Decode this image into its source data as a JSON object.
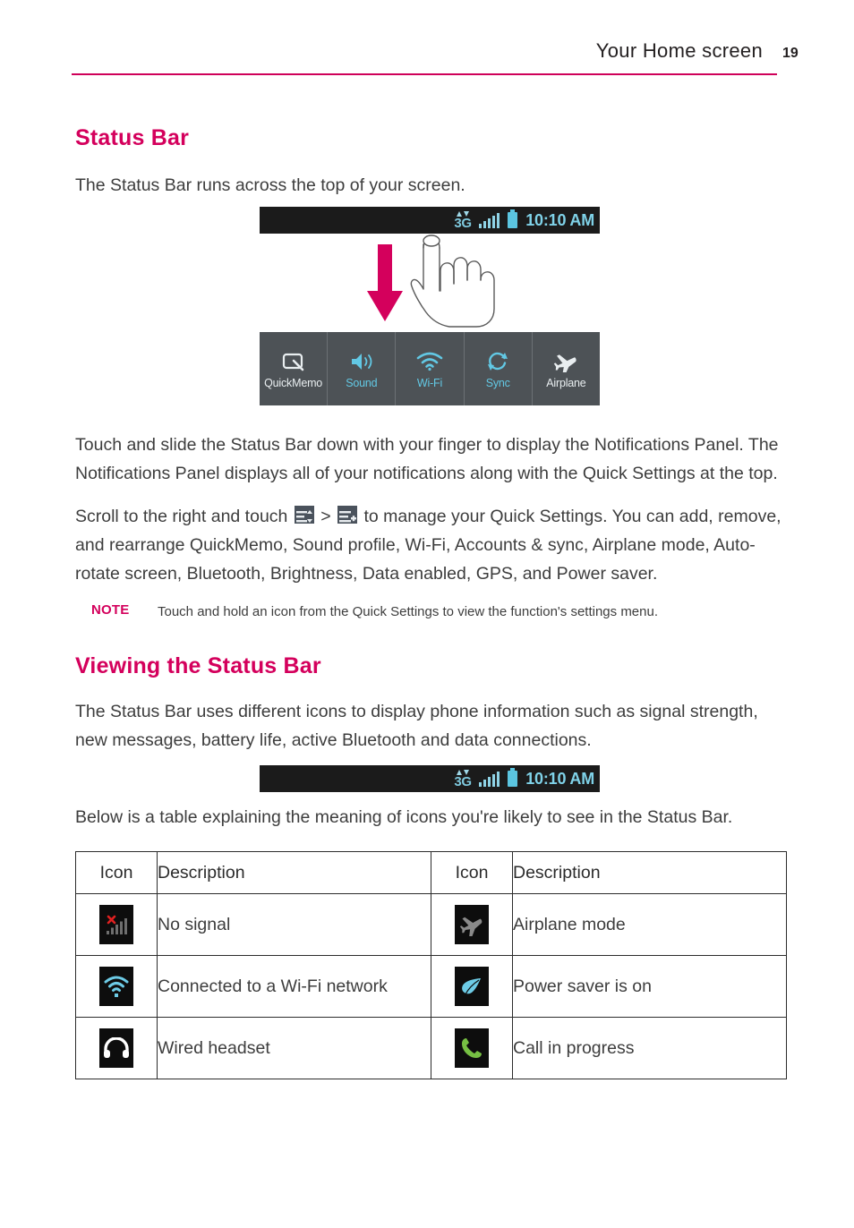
{
  "header": {
    "title": "Your Home screen",
    "page_number": "19",
    "rule_color": "#cf0059"
  },
  "sections": [
    {
      "heading": "Status Bar",
      "intro": "The Status Bar runs across the top of your screen."
    },
    {
      "heading": "Viewing the Status Bar",
      "intro": "The Status Bar uses different icons to display phone information such as signal strength, new messages, battery life, active Bluetooth and data connections."
    }
  ],
  "status_bar": {
    "network_label": "3G",
    "clock": "10:10 AM",
    "icons": [
      "data-up-down-arrows-icon",
      "signal-bars-icon",
      "battery-icon"
    ],
    "background": "#1b1b1b",
    "accent": "#7fd2e8"
  },
  "quick_settings": {
    "items": [
      {
        "label": "QuickMemo",
        "icon": "quickmemo-icon",
        "state": "inactive"
      },
      {
        "label": "Sound",
        "icon": "sound-speaker-icon",
        "state": "active"
      },
      {
        "label": "Wi-Fi",
        "icon": "wifi-icon",
        "state": "active"
      },
      {
        "label": "Sync",
        "icon": "sync-icon",
        "state": "active"
      },
      {
        "label": "Airplane",
        "icon": "airplane-icon",
        "state": "inactive"
      }
    ],
    "background": "#4d5256",
    "active_color": "#62c8e4",
    "inactive_color": "#e9eef0"
  },
  "paragraphs": {
    "p_notifications": "Touch and slide the Status Bar down with your finger to display the Notifications Panel. The Notifications Panel displays all of your notifications along with the Quick Settings at the top.",
    "p_manage_pre": "Scroll to the right and touch ",
    "p_manage_sep": " > ",
    "p_manage_post": " to manage your Quick Settings. You can add, remove, and rearrange QuickMemo, Sound profile, Wi-Fi, Accounts & sync, Airplane mode, Auto-rotate screen, Bluetooth, Brightness, Data enabled, GPS, and Power saver.",
    "p_below_table": "Below is a table explaining the meaning of icons you're likely to see in the Status Bar."
  },
  "note": {
    "label": "NOTE",
    "text": "Touch and hold an icon from the Quick Settings to view the function's settings menu."
  },
  "table": {
    "headers": [
      "Icon",
      "Description",
      "Icon",
      "Description"
    ],
    "rows": [
      {
        "left_icon": "no-signal-icon",
        "left_desc": "No signal",
        "right_icon": "airplane-mode-icon",
        "right_desc": "Airplane mode"
      },
      {
        "left_icon": "wifi-connected-icon",
        "left_desc": "Connected to a Wi-Fi network",
        "right_icon": "power-saver-leaf-icon",
        "right_desc": "Power saver is on"
      },
      {
        "left_icon": "wired-headset-icon",
        "left_desc": "Wired headset",
        "right_icon": "call-in-progress-icon",
        "right_desc": "Call in progress"
      }
    ]
  },
  "colors": {
    "heading_magenta": "#d4005c",
    "body_gray": "#3d3d3d",
    "icon_cyan": "#6dcbe6",
    "icon_green": "#76c043",
    "icon_red": "#e02020"
  }
}
